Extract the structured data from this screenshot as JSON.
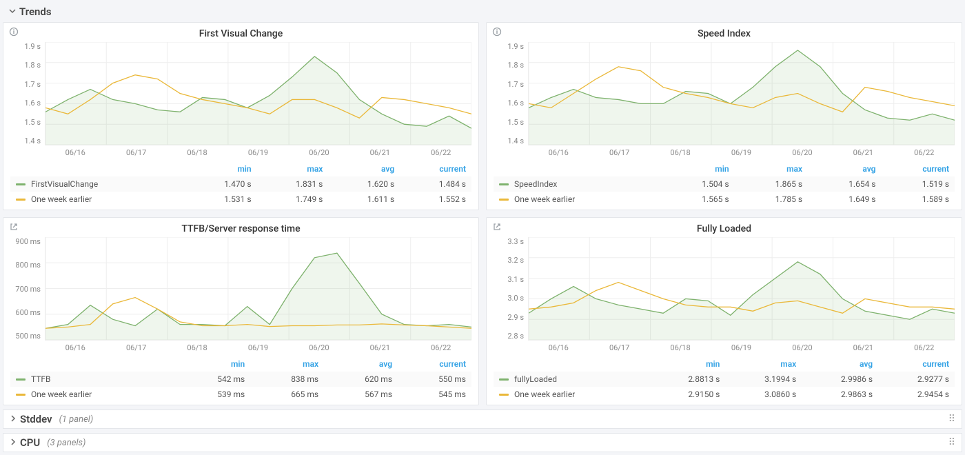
{
  "rows": {
    "trends": {
      "title": "Trends",
      "expanded": true
    },
    "stddev": {
      "title": "Stddev",
      "count": "(1 panel)",
      "expanded": false
    },
    "cpu": {
      "title": "CPU",
      "count": "(3 panels)",
      "expanded": false
    }
  },
  "legend_headers": {
    "min": "min",
    "max": "max",
    "avg": "avg",
    "current": "current"
  },
  "xticks": [
    "06/16",
    "06/17",
    "06/18",
    "06/19",
    "06/20",
    "06/21",
    "06/22"
  ],
  "panels": {
    "fvc": {
      "title": "First Visual Change",
      "icon": "info",
      "yticks": [
        "1.9 s",
        "1.8 s",
        "1.7 s",
        "1.6 s",
        "1.5 s",
        "1.4 s"
      ],
      "series": [
        {
          "name": "FirstVisualChange",
          "min": "1.470 s",
          "max": "1.831 s",
          "avg": "1.620 s",
          "current": "1.484 s"
        },
        {
          "name": "One week earlier",
          "min": "1.531 s",
          "max": "1.749 s",
          "avg": "1.611 s",
          "current": "1.552 s"
        }
      ]
    },
    "si": {
      "title": "Speed Index",
      "icon": "info",
      "yticks": [
        "1.9 s",
        "1.8 s",
        "1.7 s",
        "1.6 s",
        "1.5 s",
        "1.4 s"
      ],
      "series": [
        {
          "name": "SpeedIndex",
          "min": "1.504 s",
          "max": "1.865 s",
          "avg": "1.654 s",
          "current": "1.519 s"
        },
        {
          "name": "One week earlier",
          "min": "1.565 s",
          "max": "1.785 s",
          "avg": "1.649 s",
          "current": "1.589 s"
        }
      ]
    },
    "ttfb": {
      "title": "TTFB/Server response time",
      "icon": "link",
      "yticks": [
        "900 ms",
        "800 ms",
        "700 ms",
        "600 ms",
        "500 ms"
      ],
      "series": [
        {
          "name": "TTFB",
          "min": "542 ms",
          "max": "838 ms",
          "avg": "620 ms",
          "current": "550 ms"
        },
        {
          "name": "One week earlier",
          "min": "539 ms",
          "max": "665 ms",
          "avg": "567 ms",
          "current": "545 ms"
        }
      ]
    },
    "fl": {
      "title": "Fully Loaded",
      "icon": "link",
      "yticks": [
        "3.3 s",
        "3.2 s",
        "3.1 s",
        "3.0 s",
        "2.9 s",
        "2.8 s"
      ],
      "series": [
        {
          "name": "fullyLoaded",
          "min": "2.8813 s",
          "max": "3.1994 s",
          "avg": "2.9986 s",
          "current": "2.9277 s"
        },
        {
          "name": "One week earlier",
          "min": "2.9150 s",
          "max": "3.0860 s",
          "avg": "2.9863 s",
          "current": "2.9454 s"
        }
      ]
    }
  },
  "chart_data": [
    {
      "panel": "fvc",
      "type": "line",
      "title": "First Visual Change",
      "xlabel": "",
      "ylabel": "",
      "ylim": [
        1.4,
        1.9
      ],
      "x": [
        "06/16",
        "06/17",
        "06/18",
        "06/19",
        "06/20",
        "06/21",
        "06/22"
      ],
      "series": [
        {
          "name": "FirstVisualChange",
          "values": [
            1.56,
            1.62,
            1.67,
            1.62,
            1.6,
            1.57,
            1.56,
            1.63,
            1.62,
            1.58,
            1.64,
            1.73,
            1.83,
            1.75,
            1.62,
            1.55,
            1.5,
            1.49,
            1.54,
            1.48
          ]
        },
        {
          "name": "One week earlier",
          "values": [
            1.58,
            1.55,
            1.62,
            1.7,
            1.74,
            1.72,
            1.65,
            1.62,
            1.6,
            1.58,
            1.55,
            1.62,
            1.62,
            1.58,
            1.53,
            1.63,
            1.62,
            1.6,
            1.58,
            1.55
          ]
        }
      ]
    },
    {
      "panel": "si",
      "type": "line",
      "title": "Speed Index",
      "ylim": [
        1.4,
        1.9
      ],
      "x": [
        "06/16",
        "06/17",
        "06/18",
        "06/19",
        "06/20",
        "06/21",
        "06/22"
      ],
      "series": [
        {
          "name": "SpeedIndex",
          "values": [
            1.58,
            1.63,
            1.67,
            1.63,
            1.62,
            1.6,
            1.6,
            1.66,
            1.65,
            1.6,
            1.68,
            1.78,
            1.86,
            1.78,
            1.65,
            1.57,
            1.53,
            1.52,
            1.55,
            1.52
          ]
        },
        {
          "name": "One week earlier",
          "values": [
            1.6,
            1.58,
            1.65,
            1.72,
            1.78,
            1.76,
            1.68,
            1.65,
            1.63,
            1.6,
            1.58,
            1.63,
            1.65,
            1.6,
            1.56,
            1.68,
            1.66,
            1.63,
            1.61,
            1.59
          ]
        }
      ]
    },
    {
      "panel": "ttfb",
      "type": "line",
      "title": "TTFB/Server response time",
      "ylim": [
        500,
        900
      ],
      "x": [
        "06/16",
        "06/17",
        "06/18",
        "06/19",
        "06/20",
        "06/21",
        "06/22"
      ],
      "series": [
        {
          "name": "TTFB",
          "values": [
            545,
            560,
            635,
            580,
            555,
            620,
            560,
            560,
            555,
            630,
            560,
            700,
            820,
            838,
            720,
            600,
            560,
            555,
            560,
            550
          ]
        },
        {
          "name": "One week earlier",
          "values": [
            545,
            550,
            560,
            640,
            665,
            620,
            570,
            555,
            555,
            560,
            552,
            555,
            555,
            558,
            558,
            562,
            558,
            555,
            550,
            545
          ]
        }
      ]
    },
    {
      "panel": "fl",
      "type": "line",
      "title": "Fully Loaded",
      "ylim": [
        2.8,
        3.3
      ],
      "x": [
        "06/16",
        "06/17",
        "06/18",
        "06/19",
        "06/20",
        "06/21",
        "06/22"
      ],
      "series": [
        {
          "name": "fullyLoaded",
          "values": [
            2.93,
            3.0,
            3.06,
            3.0,
            2.97,
            2.95,
            2.93,
            3.0,
            2.99,
            2.92,
            3.02,
            3.1,
            3.18,
            3.12,
            3.0,
            2.94,
            2.92,
            2.9,
            2.95,
            2.93
          ]
        },
        {
          "name": "One week earlier",
          "values": [
            2.95,
            2.96,
            2.98,
            3.04,
            3.08,
            3.04,
            3.0,
            2.97,
            2.96,
            2.96,
            2.94,
            2.98,
            2.99,
            2.96,
            2.93,
            3.0,
            2.98,
            2.96,
            2.96,
            2.95
          ]
        }
      ]
    }
  ]
}
